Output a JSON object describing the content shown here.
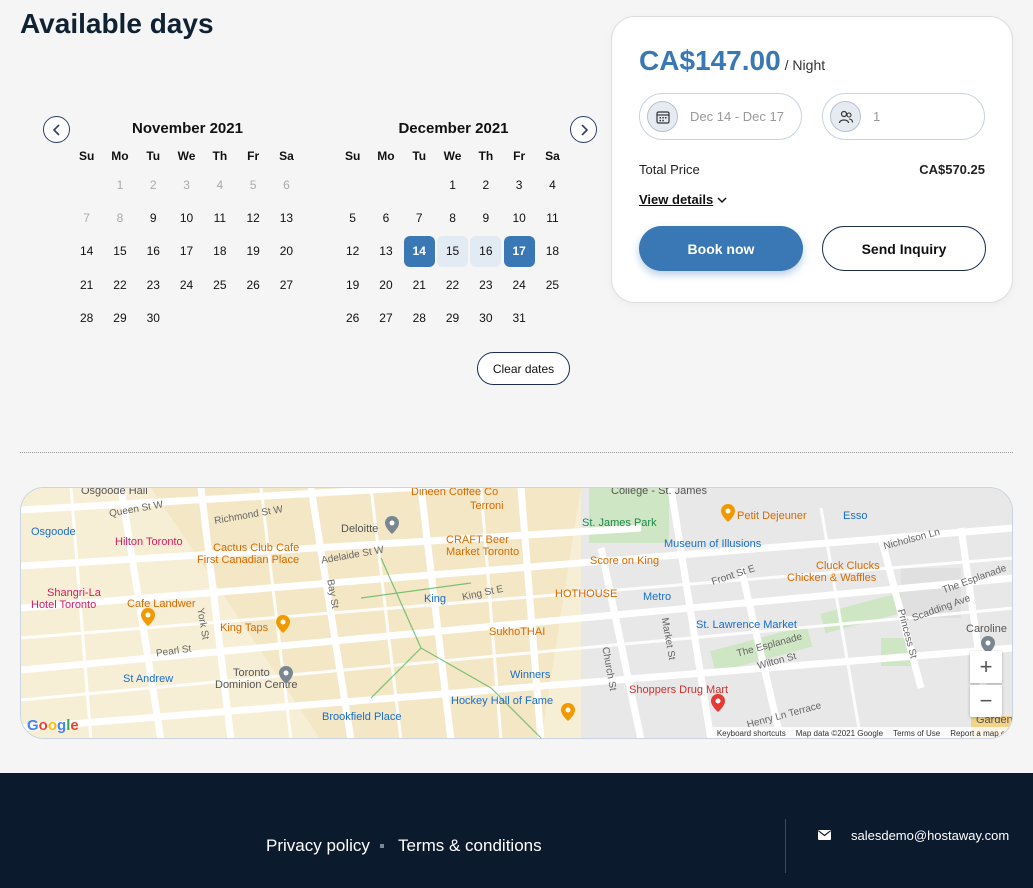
{
  "page": {
    "title": "Available days"
  },
  "calendar": {
    "prev_label": "‹",
    "next_label": "›",
    "weekdays": [
      "Su",
      "Mo",
      "Tu",
      "We",
      "Th",
      "Fr",
      "Sa"
    ],
    "months": [
      {
        "title": "November 2021",
        "offset": 1,
        "days": 30,
        "past_until": 8,
        "selected": [],
        "range": []
      },
      {
        "title": "December 2021",
        "offset": 3,
        "days": 31,
        "past_until": 0,
        "selected": [
          14,
          17
        ],
        "range": [
          15,
          16
        ]
      }
    ],
    "clear_label": "Clear dates"
  },
  "booking": {
    "price": "CA$147.00",
    "price_unit": "/ Night",
    "dates_value": "Dec 14 - Dec 17",
    "guests_value": "1",
    "total_label": "Total Price",
    "total_value": "CA$570.25",
    "view_details": "View details",
    "book_label": "Book now",
    "inquiry_label": "Send Inquiry"
  },
  "map": {
    "labels": [
      {
        "text": "Osgoode Hall",
        "cls": "lbl-gray"
      },
      {
        "text": "Queen St W",
        "cls": "lbl-street"
      },
      {
        "text": "Osgoode",
        "cls": "lbl-blue"
      },
      {
        "text": "Richmond St W",
        "cls": "lbl-street"
      },
      {
        "text": "Deloitte",
        "cls": "lbl-gray"
      },
      {
        "text": "Hilton Toronto",
        "cls": "lbl-pink"
      },
      {
        "text": "Cactus Club Cafe",
        "cls": "lbl-orange"
      },
      {
        "text": "First Canadian Place",
        "cls": "lbl-orange"
      },
      {
        "text": "Adelaide St W",
        "cls": "lbl-street"
      },
      {
        "text": "Dineen Coffee Co",
        "cls": "lbl-orange"
      },
      {
        "text": "Terroni",
        "cls": "lbl-orange"
      },
      {
        "text": "CRAFT Beer",
        "cls": "lbl-orange"
      },
      {
        "text": "Market Toronto",
        "cls": "lbl-orange"
      },
      {
        "text": "College - St. James",
        "cls": "lbl-gray"
      },
      {
        "text": "St. James Park",
        "cls": "lbl-green"
      },
      {
        "text": "Museum of Illusions",
        "cls": "lbl-blue"
      },
      {
        "text": "Petit Dejeuner",
        "cls": "lbl-orange"
      },
      {
        "text": "Esso",
        "cls": "lbl-blue"
      },
      {
        "text": "Score on King",
        "cls": "lbl-orange"
      },
      {
        "text": "Shangri-La",
        "cls": "lbl-pink"
      },
      {
        "text": "Hotel Toronto",
        "cls": "lbl-pink"
      },
      {
        "text": "Cafe Landwer",
        "cls": "lbl-orange"
      },
      {
        "text": "King",
        "cls": "lbl-blue"
      },
      {
        "text": "King St E",
        "cls": "lbl-street"
      },
      {
        "text": "HOTHOUSE",
        "cls": "lbl-orange"
      },
      {
        "text": "Metro",
        "cls": "lbl-blue"
      },
      {
        "text": "Front St E",
        "cls": "lbl-street"
      },
      {
        "text": "Cluck Clucks",
        "cls": "lbl-orange"
      },
      {
        "text": "Chicken & Waffles",
        "cls": "lbl-orange"
      },
      {
        "text": "King Taps",
        "cls": "lbl-orange"
      },
      {
        "text": "SukhoTHAI",
        "cls": "lbl-orange"
      },
      {
        "text": "St. Lawrence Market",
        "cls": "lbl-blue"
      },
      {
        "text": "Toronto",
        "cls": "lbl-gray"
      },
      {
        "text": "Dominion Centre",
        "cls": "lbl-gray"
      },
      {
        "text": "St Andrew",
        "cls": "lbl-blue"
      },
      {
        "text": "Winners",
        "cls": "lbl-blue"
      },
      {
        "text": "Shoppers Drug Mart",
        "cls": "lbl-red"
      },
      {
        "text": "Hockey Hall of Fame",
        "cls": "lbl-blue"
      },
      {
        "text": "Brookfield Place",
        "cls": "lbl-blue"
      },
      {
        "text": "Caroline",
        "cls": "lbl-gray"
      },
      {
        "text": "Bay St",
        "cls": "lbl-street"
      },
      {
        "text": "York St",
        "cls": "lbl-street"
      },
      {
        "text": "Pearl St",
        "cls": "lbl-street"
      },
      {
        "text": "Market St",
        "cls": "lbl-street"
      },
      {
        "text": "Church St",
        "cls": "lbl-street"
      },
      {
        "text": "The Esplanade",
        "cls": "lbl-street"
      },
      {
        "text": "Wilton St",
        "cls": "lbl-street"
      },
      {
        "text": "Henry Ln Terrace",
        "cls": "lbl-street"
      },
      {
        "text": "Princess St",
        "cls": "lbl-street"
      },
      {
        "text": "Nicholson Ln",
        "cls": "lbl-street"
      },
      {
        "text": "Scadding Ave",
        "cls": "lbl-street"
      },
      {
        "text": "The Esplanade",
        "cls": "lbl-street"
      },
      {
        "text": "Garden",
        "cls": "lbl-gray"
      }
    ],
    "zoom_in": "+",
    "zoom_out": "−",
    "google": "Google",
    "attribution": [
      "Keyboard shortcuts",
      "Map data ©2021 Google",
      "Terms of Use",
      "Report a map er"
    ]
  },
  "footer": {
    "privacy": "Privacy policy",
    "terms": "Terms & conditions",
    "email": "salesdemo@hostaway.com"
  },
  "colors": {
    "accent": "#3a77b5",
    "footer_bg": "#0c1a2e",
    "range_bg": "#e2eaf4"
  }
}
